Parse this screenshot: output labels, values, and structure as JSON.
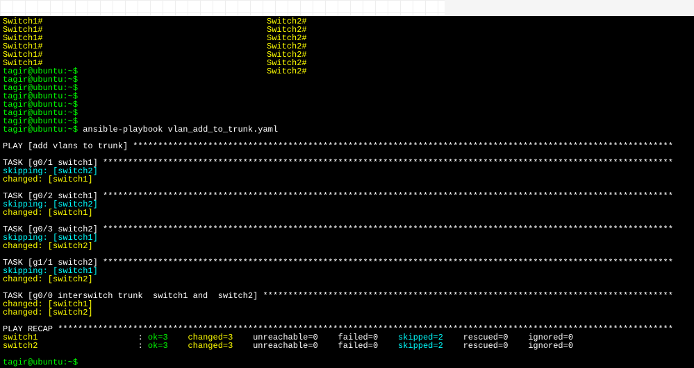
{
  "header": {
    "left_prompt": "Switch1#",
    "right_prompt": "Switch2#",
    "rows": 6,
    "bottom_overlap": "tagir@ubuntu:~$"
  },
  "shell": {
    "prompt": "tagir@ubuntu:~$",
    "blank_count": 6,
    "command": "ansible-playbook vlan_add_to_trunk.yaml"
  },
  "play": {
    "header": "PLAY [add vlans to trunk] ************************************************************************************************************"
  },
  "tasks": [
    {
      "header": "TASK [g0/1 switch1] ******************************************************************************************************************",
      "lines": [
        {
          "cls": "cyan",
          "text": "skipping: [switch2]"
        },
        {
          "cls": "yellow",
          "text": "changed: [switch1]"
        }
      ]
    },
    {
      "header": "TASK [g0/2 switch1] ******************************************************************************************************************",
      "lines": [
        {
          "cls": "cyan",
          "text": "skipping: [switch2]"
        },
        {
          "cls": "yellow",
          "text": "changed: [switch1]"
        }
      ]
    },
    {
      "header": "TASK [g0/3 switch2] ******************************************************************************************************************",
      "lines": [
        {
          "cls": "cyan",
          "text": "skipping: [switch1]"
        },
        {
          "cls": "yellow",
          "text": "changed: [switch2]"
        }
      ]
    },
    {
      "header": "TASK [g1/1 switch2] ******************************************************************************************************************",
      "lines": [
        {
          "cls": "cyan",
          "text": "skipping: [switch1]"
        },
        {
          "cls": "yellow",
          "text": "changed: [switch2]"
        }
      ]
    },
    {
      "header": "TASK [g0/0 interswitch trunk  switch1 and  switch2] **********************************************************************************",
      "lines": [
        {
          "cls": "yellow",
          "text": "changed: [switch1]"
        },
        {
          "cls": "yellow",
          "text": "changed: [switch2]"
        }
      ]
    }
  ],
  "recap": {
    "header": "PLAY RECAP ***************************************************************************************************************************",
    "rows": [
      {
        "host": "switch1",
        "ok": "ok=3",
        "changed": "changed=3",
        "unreachable": "unreachable=0",
        "failed": "failed=0",
        "skipped": "skipped=2",
        "rescued": "rescued=0",
        "ignored": "ignored=0"
      },
      {
        "host": "switch2",
        "ok": "ok=3",
        "changed": "changed=3",
        "unreachable": "unreachable=0",
        "failed": "failed=0",
        "skipped": "skipped=2",
        "rescued": "rescued=0",
        "ignored": "ignored=0"
      }
    ]
  },
  "footer_prompt": "tagir@ubuntu:~$"
}
